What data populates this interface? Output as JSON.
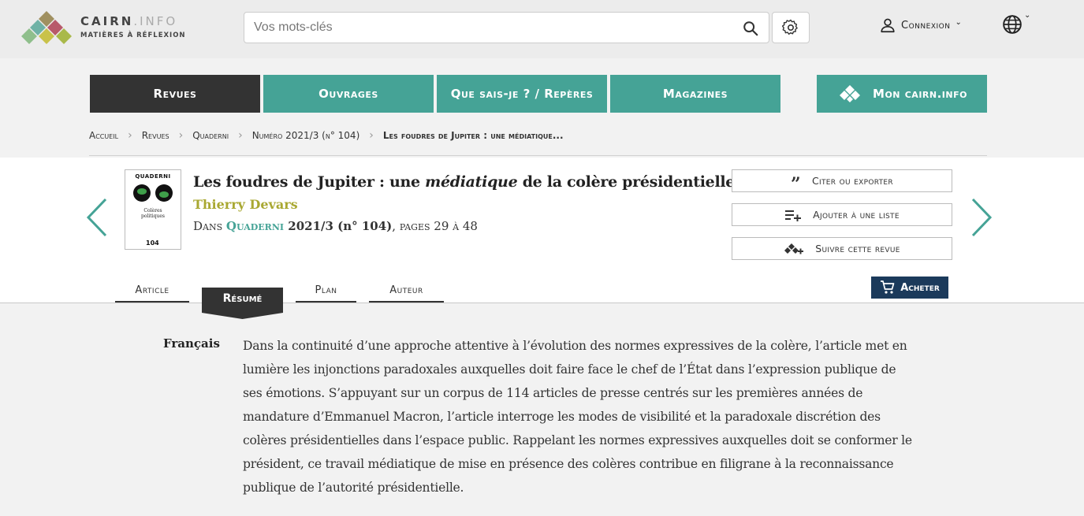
{
  "brand": {
    "name": "CAIRN",
    "name_suffix": ".INFO",
    "tagline": "MATIÈRES À RÉFLEXION",
    "colors": [
      "#a09060",
      "#b85a6a",
      "#6fb2a6",
      "#a9b94a",
      "#8fbf8c",
      "#c9c24a"
    ]
  },
  "header": {
    "search_placeholder": "Vos mots-clés",
    "search_icon": "search-icon",
    "settings_icon": "gear-icon",
    "login_label": "Connexion",
    "language_icon": "globe-icon"
  },
  "nav": {
    "tabs": [
      {
        "label": "Revues",
        "active": true
      },
      {
        "label": "Ouvrages",
        "active": false
      },
      {
        "label": "Que sais-je ? / Repères",
        "active": false
      },
      {
        "label": "Magazines",
        "active": false
      }
    ],
    "account_label": "Mon cairn.info",
    "colors": {
      "active": "#333333",
      "tab": "#45a396"
    }
  },
  "breadcrumb": [
    "Accueil",
    "Revues",
    "Quaderni",
    "Numéro 2021/3 (n° 104)",
    "Les foudres de Jupiter : une médiatique..."
  ],
  "article": {
    "title_before": "Les foudres de Jupiter : une ",
    "title_em": "médiatique",
    "title_after": " de la colère présidentielle",
    "author": "Thierry Devars",
    "source_prefix": "Dans ",
    "journal": "Quaderni",
    "issue": " 2021/3 (n° 104)",
    "pages": ", pages 29 à 48",
    "cover": {
      "title": "QUADERNI",
      "subtitle_line1": "Colères",
      "subtitle_line2": "politiques",
      "number": "104"
    },
    "author_color": "#a9a832",
    "journal_color": "#45a396"
  },
  "actions": {
    "cite": "Citer ou exporter",
    "add_list": "Ajouter à une liste",
    "follow": "Suivre cette revue",
    "buy": "Acheter",
    "buy_color": "#1b3a5b"
  },
  "tabs": {
    "article": "Article",
    "resume": "Résumé",
    "plan": "Plan",
    "auteur": "Auteur",
    "active": "resume"
  },
  "abstract": {
    "language": "Français",
    "text": "Dans la continuité d’une approche attentive à l’évolution des normes expressives de la colère, l’article met en lumière les injonctions paradoxales auxquelles doit faire face le chef de l’État dans l’expression publique de ses émotions. S’appuyant sur un corpus de 114 articles de presse centrés sur les premières années de mandature d’Emmanuel Macron, l’article interroge les modes de visibilité et la paradoxale discrétion des colères présidentielles dans l’espace public. Rappelant les normes expressives auxquelles doit se conformer le président, ce travail médiatique de mise en présence des colères contribue en filigrane à la reconnaissance publique de l’autorité présidentielle."
  }
}
